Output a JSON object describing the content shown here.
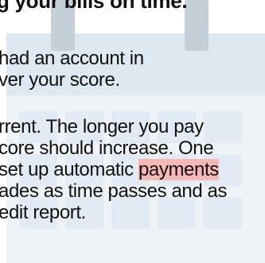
{
  "heading": "g your bills on time.",
  "paragraph1": {
    "lines": [
      "had an account in",
      "ver your score."
    ]
  },
  "paragraph2": {
    "lines": [
      "rrent. The longer you pay",
      "core should increase. One",
      "set up automatic ",
      "ades as time passes and as",
      "edit report."
    ],
    "highlighted_word": "payments"
  },
  "colors": {
    "calendar_header": "#dde8f1",
    "calendar_body": "#eef3f8",
    "calendar_cell": "#e2ebf3",
    "calendar_ring": "#c4cfd8",
    "highlight": "#f6b7b7"
  }
}
